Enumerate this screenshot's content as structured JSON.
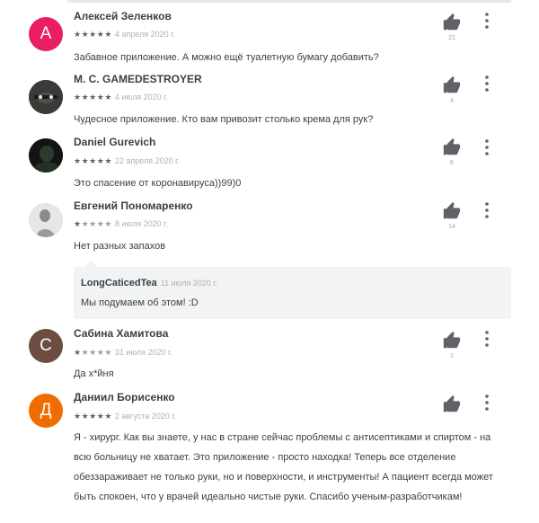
{
  "reviews": [
    {
      "author": "Алексей Зеленков",
      "avatar_letter": "А",
      "avatar_color": "#e91e63",
      "rating": 5,
      "date": "4 апреля 2020 г.",
      "text": "Забавное приложение. А можно ещё туалетную бумагу добавить?",
      "likes": "21"
    },
    {
      "author": "M. C. GAMEDESTROYER",
      "avatar_letter": "",
      "avatar_color": "#2b2b2b",
      "rating": 5,
      "date": "4 июля 2020 г.",
      "text": "Чудесное приложение. Кто вам привозит столько крема для рук?",
      "likes": "4"
    },
    {
      "author": "Daniel Gurevich",
      "avatar_letter": "",
      "avatar_color": "#1e1e1e",
      "rating": 5,
      "date": "22 апреля 2020 г.",
      "text": "Это спасение от коронавируса))99)0",
      "likes": "6"
    },
    {
      "author": "Евгений Пономаренко",
      "avatar_letter": "",
      "avatar_color": "#d9d9d9",
      "rating": 1,
      "date": "8 июля 2020 г.",
      "text": "Нет разных запахов",
      "likes": "14",
      "reply": {
        "author": "LongCaticedTea",
        "date": "11 июля 2020 г.",
        "text": "Мы подумаем об этом! :D"
      }
    },
    {
      "author": "Сабина Хамитова",
      "avatar_letter": "С",
      "avatar_color": "#6d4c41",
      "rating": 1,
      "date": "31 июля 2020 г.",
      "text": "Да х*йня",
      "likes": "1"
    },
    {
      "author": "Даниил Борисенко",
      "avatar_letter": "Д",
      "avatar_color": "#ef6c00",
      "rating": 5,
      "date": "2 августа 2020 г.",
      "text": "Я - хирург. Как вы знаете, у нас в стране сейчас проблемы с антисептиками и спиртом - на всю больницу не хватает. Это приложение - просто находка! Теперь все отделение обеззараживает не только руки, но и поверхности, и инструменты! А пациент всегда может быть спокоен, что у врачей идеально чистые руки. Спасибо ученым-разработчикам!",
      "likes": ""
    }
  ],
  "icons": {
    "like": "thumbs-up-icon",
    "more": "more-vertical-icon"
  }
}
